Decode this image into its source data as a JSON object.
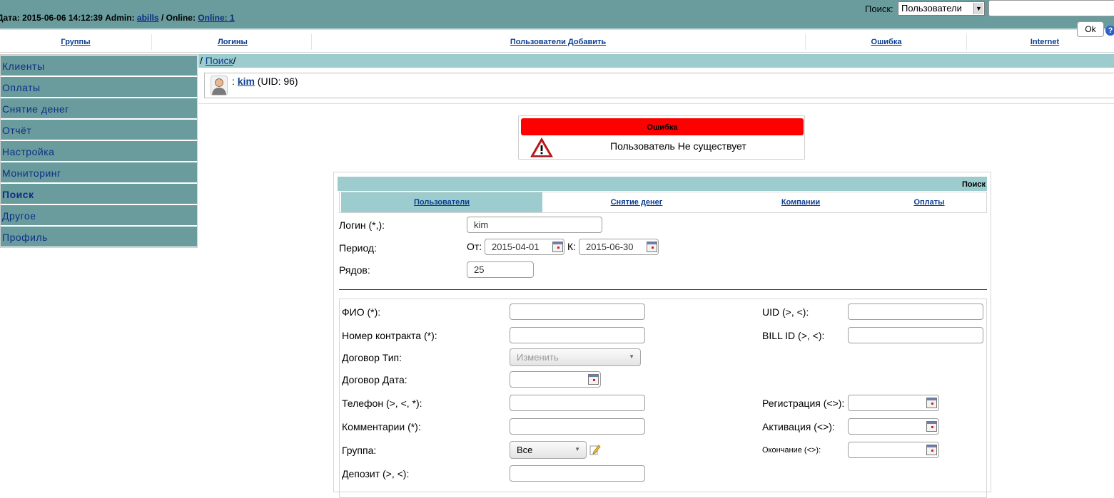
{
  "topbar": {
    "date_label": "Дата:",
    "date_value": "2015-06-06 14:12:39",
    "admin_label": "Admin:",
    "admin_name": "abills",
    "online_label": "/ Online:",
    "online_value": "Online: 1",
    "search_label": "Поиск:",
    "search_select_value": "Пользователи",
    "search_input_value": "",
    "ok_label": "Ok",
    "help_label": "?"
  },
  "menu": [
    {
      "label": "Группы"
    },
    {
      "label": "Логины"
    },
    {
      "label": "Пользователи Добавить"
    },
    {
      "label": "Ошибка"
    },
    {
      "label": "Internet"
    }
  ],
  "sidebar": {
    "items": [
      {
        "label": "Клиенты"
      },
      {
        "label": "Оплаты"
      },
      {
        "label": "Снятие денег"
      },
      {
        "label": "Отчёт"
      },
      {
        "label": "Настройка"
      },
      {
        "label": "Мониторинг"
      },
      {
        "label": "Поиск",
        "active": true
      },
      {
        "label": "Другое"
      },
      {
        "label": "Профиль"
      }
    ]
  },
  "breadcrumb": {
    "prefix": "/",
    "link": "Поиск",
    "suffix": "/"
  },
  "user": {
    "separator": ":",
    "login": "kim",
    "uid_text": "(UID: 96)"
  },
  "error": {
    "title": "Ошибка",
    "message": "Пользователь Не существует"
  },
  "search_form": {
    "title": "Поиск",
    "tabs": [
      {
        "label": "Пользователи",
        "active": true
      },
      {
        "label": "Снятие денег"
      },
      {
        "label": "Компании"
      },
      {
        "label": "Оплаты"
      }
    ],
    "login_label": "Логин (*,):",
    "login_value": "kim",
    "period_label": "Период:",
    "from_label": "От:",
    "from_value": "2015-04-01",
    "to_label": "К:",
    "to_value": "2015-06-30",
    "rows_label": "Рядов:",
    "rows_value": "25",
    "fields": {
      "fio_label": "ФИО (*):",
      "contract_label": "Номер контракта (*):",
      "contract_type_label": "Договор Тип:",
      "contract_type_value": "Изменить",
      "contract_date_label": "Договор Дата:",
      "phone_label": "Телефон (>, <, *):",
      "comments_label": "Комментарии (*):",
      "group_label": "Группа:",
      "group_value": "Все",
      "deposit_label": "Депозит (>, <):",
      "uid_label": "UID (>, <):",
      "bill_label": "BILL ID (>, <):",
      "registration_label": "Регистрация (<>):",
      "activation_label": "Активация (<>):",
      "expire_label": "Окончание (<>):"
    }
  }
}
